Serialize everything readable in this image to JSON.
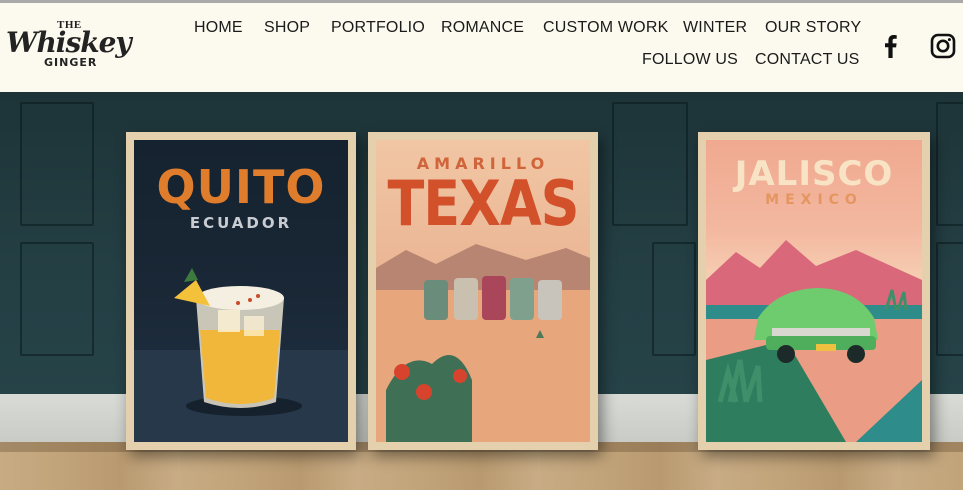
{
  "brand": {
    "the": "THE",
    "script": "Whiskey",
    "ginger": "GINGER"
  },
  "nav": {
    "row1": [
      "HOME",
      "SHOP",
      "PORTFOLIO",
      "ROMANCE",
      "CUSTOM WORK",
      "WINTER",
      "OUR STORY"
    ],
    "row2": [
      "FOLLOW US",
      "CONTACT US"
    ]
  },
  "social": {
    "facebook": "facebook-icon",
    "instagram": "instagram-icon"
  },
  "posters": [
    {
      "title": "QUITO",
      "subtitle": "ECUADOR",
      "title_color": "#e07d2c",
      "subtitle_color": "#c9ccd2"
    },
    {
      "title": "TEXAS",
      "subtitle": "AMARILLO",
      "title_color": "#d2502a",
      "subtitle_color": "#d0643a"
    },
    {
      "title": "JALISCO",
      "subtitle": "MEXICO",
      "title_color": "#f8e4c4",
      "subtitle_color": "#e59660"
    }
  ],
  "colors": {
    "header_bg": "#fcf9ee",
    "wall": "#243f44",
    "frame": "#e4d0ac"
  }
}
